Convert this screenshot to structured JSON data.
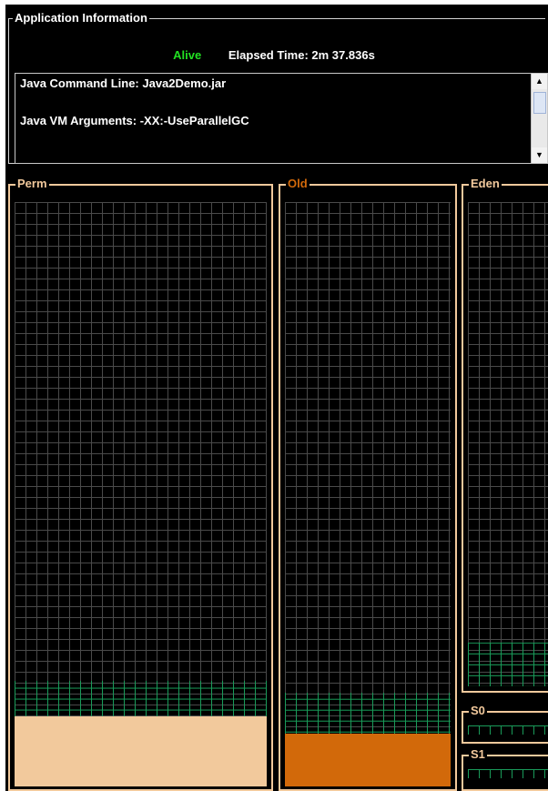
{
  "app_info": {
    "legend": "Application Information",
    "status": "Alive",
    "elapsed_label": "Elapsed Time:",
    "elapsed_value": "2m 37.836s",
    "command_line": "Java Command Line: Java2Demo.jar",
    "vm_arguments": "Java VM Arguments: -XX:-UseParallelGC"
  },
  "memory_pools": [
    {
      "name": "Perm",
      "committed_fraction": 0.18,
      "used_fraction": 0.12,
      "color": "#f2c99c"
    },
    {
      "name": "Old",
      "committed_fraction": 0.16,
      "used_fraction": 0.09,
      "color": "#d2690a"
    },
    {
      "name": "Eden",
      "committed_fraction": 0.09,
      "used_fraction": 0.0,
      "color": "#f2c99c"
    },
    {
      "name": "S0",
      "committed_fraction": 0.0,
      "used_fraction": 0.0,
      "color": "#f2c99c"
    },
    {
      "name": "S1",
      "committed_fraction": 0.0,
      "used_fraction": 0.0,
      "color": "#f2c99c"
    }
  ],
  "colors": {
    "alive": "#22e022",
    "grid_line": "#4a4a4a",
    "committed_grid": "#1a9b5a",
    "panel_border": "#f2c99c"
  },
  "icons": {
    "scroll_up": "up-arrow-icon",
    "scroll_down": "down-arrow-icon"
  }
}
